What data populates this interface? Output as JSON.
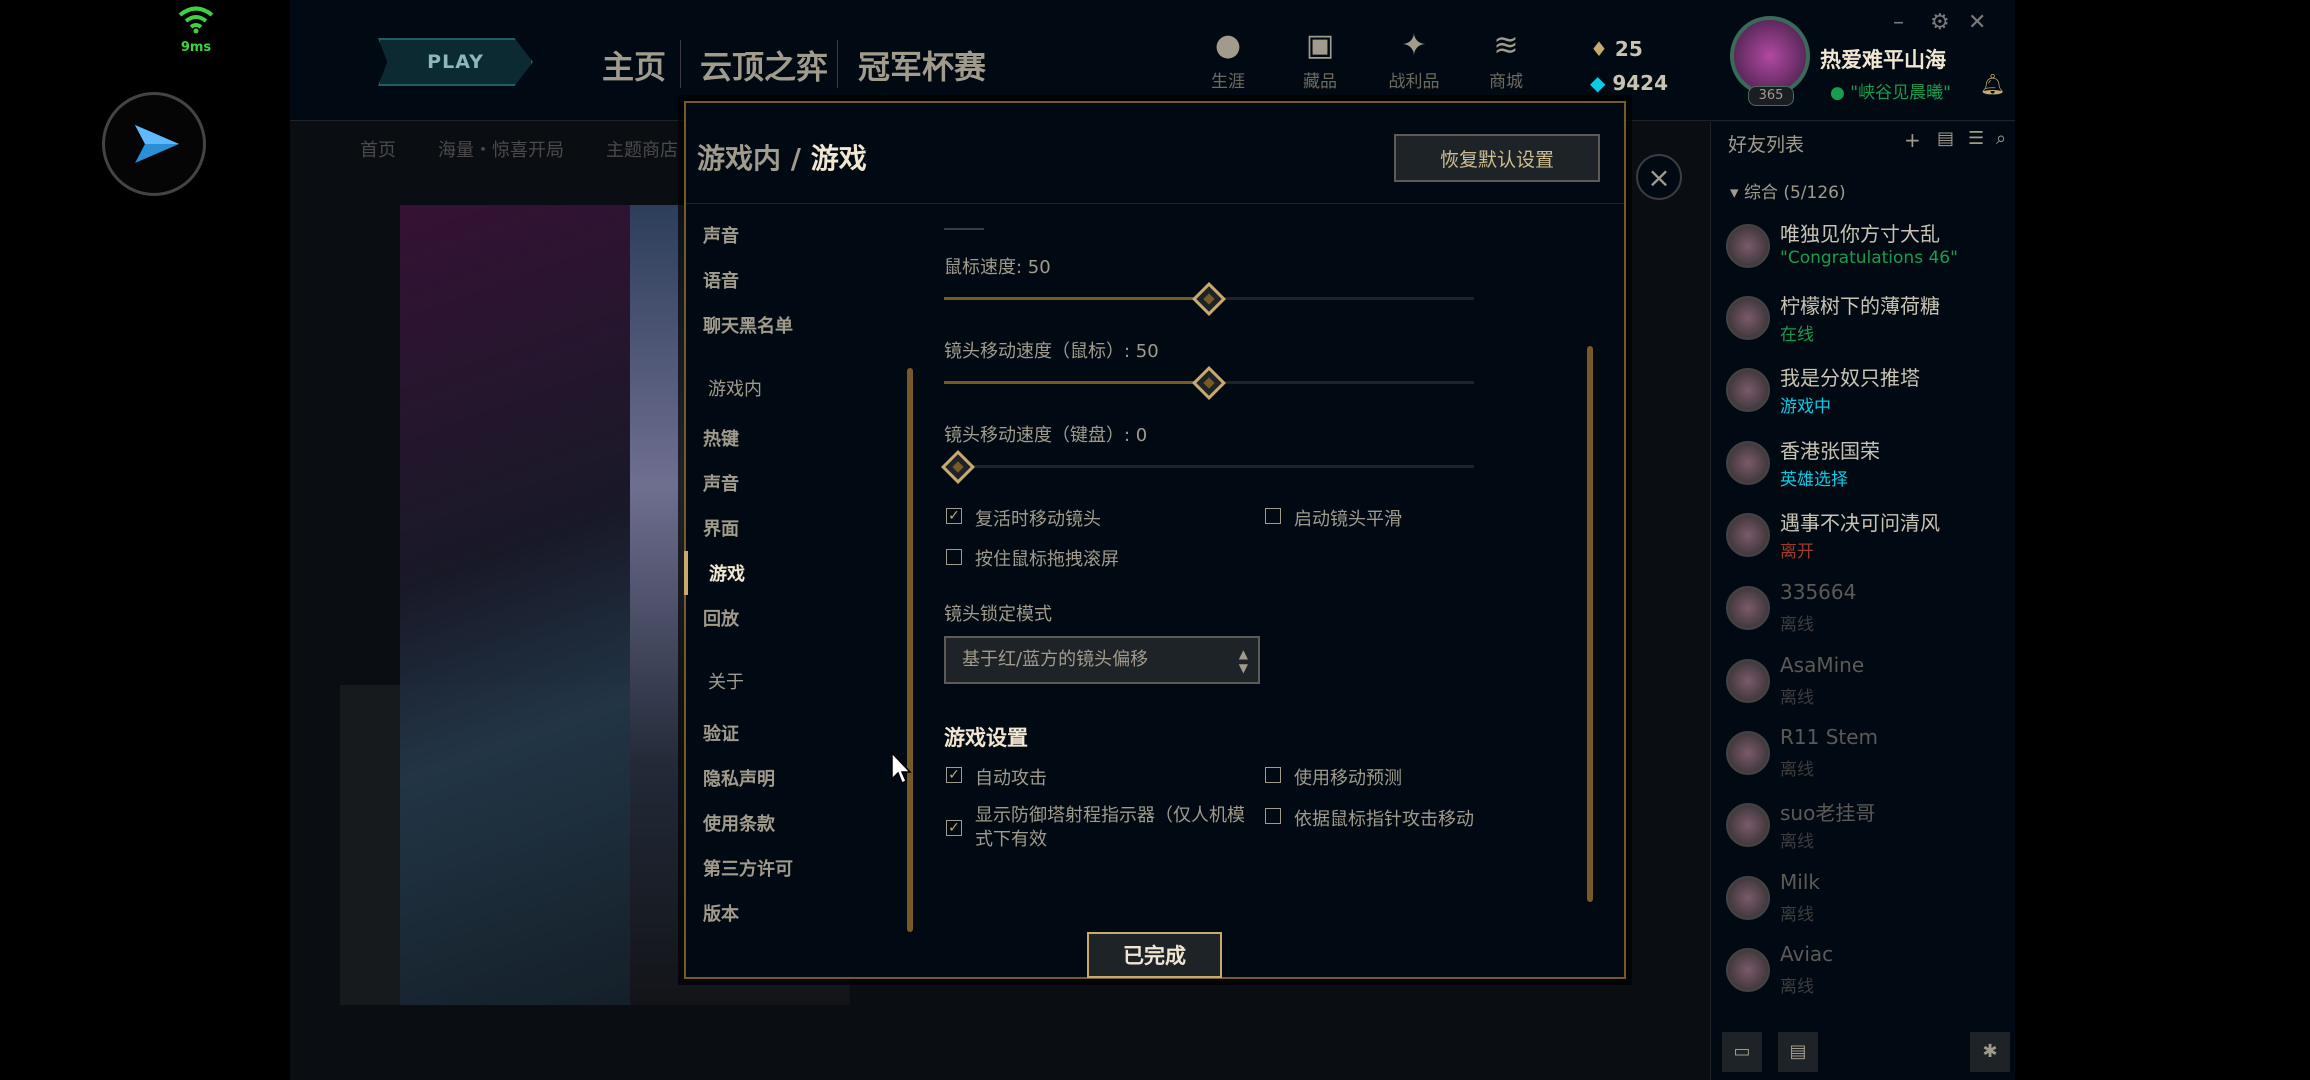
{
  "overlay": {
    "ping": "9ms"
  },
  "topbar": {
    "play": "PLAY",
    "tabs": [
      "主页",
      "云顶之弈",
      "冠军杯赛"
    ],
    "icons": [
      {
        "label": "生涯",
        "icon": "person-icon"
      },
      {
        "label": "藏品",
        "icon": "backpack-icon"
      },
      {
        "label": "战利品",
        "icon": "loot-icon"
      },
      {
        "label": "商城",
        "icon": "coins-icon"
      }
    ],
    "be": "25",
    "rp": "9424",
    "level": "365",
    "username": "热爱难平山海",
    "status": "\"峡谷见晨曦\""
  },
  "subnav": {
    "items": [
      "首页",
      "海量・惊喜开局",
      "主题商店"
    ]
  },
  "friends": {
    "title": "好友列表",
    "group": "综合 (5/126)",
    "list": [
      {
        "name": "唯独见你方寸大乱",
        "status": "\"Congratulations 46\""
      },
      {
        "name": "柠檬树下的薄荷糖",
        "status": "在线"
      },
      {
        "name": "我是分奴只推塔",
        "status": "游戏中"
      },
      {
        "name": "香港张国荣",
        "status": "英雄选择"
      },
      {
        "name": "遇事不决可问清风",
        "status": "离开"
      },
      {
        "name": "335664",
        "status": "离线"
      },
      {
        "name": "AsaMine",
        "status": "离线"
      },
      {
        "name": "R11 Stem",
        "status": "离线"
      },
      {
        "name": "suo老挂哥",
        "status": "离线"
      },
      {
        "name": "Milk",
        "status": "离线"
      },
      {
        "name": "Aviac",
        "status": "离线"
      }
    ]
  },
  "modal": {
    "breadcrumb_parent": "游戏内",
    "breadcrumb_sep": "/",
    "breadcrumb_current": "游戏",
    "reset": "恢复默认设置",
    "menu": {
      "top": [
        "声音",
        "语音",
        "聊天黑名单"
      ],
      "section_ingame": "游戏内",
      "ingame": [
        "热键",
        "声音",
        "界面",
        "游戏",
        "回放"
      ],
      "section_about": "关于",
      "about": [
        "验证",
        "隐私声明",
        "使用条款",
        "第三方许可",
        "版本"
      ]
    },
    "sliders": [
      {
        "label": "鼠标速度: 50",
        "value": 50
      },
      {
        "label": "镜头移动速度（鼠标）: 50",
        "value": 50
      },
      {
        "label": "镜头移动速度（键盘）: 0",
        "value": 0
      }
    ],
    "checks": {
      "respawn_move_camera": {
        "label": "复活时移动镜头",
        "checked": true
      },
      "smooth_camera": {
        "label": "启动镜头平滑",
        "checked": false
      },
      "drag_scroll": {
        "label": "按住鼠标拖拽滚屏",
        "checked": false
      },
      "auto_attack": {
        "label": "自动攻击",
        "checked": true
      },
      "move_prediction": {
        "label": "使用移动预测",
        "checked": false
      },
      "tower_range": {
        "label": "显示防御塔射程指示器（仅人机模式下有效",
        "checked": true
      },
      "cursor_attack_move": {
        "label": "依据鼠标指针攻击移动",
        "checked": false
      }
    },
    "camera_lock_label": "镜头锁定模式",
    "camera_lock_value": "基于红/蓝方的镜头偏移",
    "game_settings_title": "游戏设置",
    "done": "已完成"
  }
}
